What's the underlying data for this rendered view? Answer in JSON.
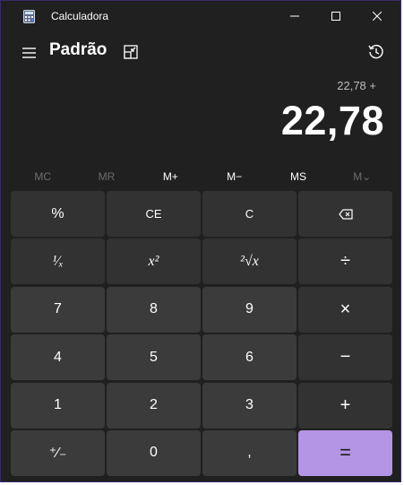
{
  "window": {
    "title": "Calculadora",
    "minimize_icon": "minimize-icon",
    "maximize_icon": "maximize-icon",
    "close_icon": "close-icon"
  },
  "header": {
    "mode": "Padrão",
    "menu_icon": "hamburger-icon",
    "keep_on_top_icon": "keep-on-top-icon",
    "history_icon": "history-icon"
  },
  "display": {
    "expression": "22,78 +",
    "result": "22,78"
  },
  "memory": [
    {
      "label": "MC",
      "enabled": false
    },
    {
      "label": "MR",
      "enabled": false
    },
    {
      "label": "M+",
      "enabled": true
    },
    {
      "label": "M−",
      "enabled": true
    },
    {
      "label": "MS",
      "enabled": true
    },
    {
      "label": "M⌄",
      "enabled": false
    }
  ],
  "keys": {
    "percent": "%",
    "clear_entry": "CE",
    "clear": "C",
    "backspace": "⌫",
    "reciprocal": "¹⁄ₓ",
    "square": "x²",
    "sqrt": "²√x",
    "divide": "÷",
    "seven": "7",
    "eight": "8",
    "nine": "9",
    "multiply": "×",
    "four": "4",
    "five": "5",
    "six": "6",
    "minus": "−",
    "one": "1",
    "two": "2",
    "three": "3",
    "plus": "+",
    "negate": "⁺∕₋",
    "zero": "0",
    "decimal": ",",
    "equals": "="
  },
  "colors": {
    "background": "#202020",
    "function_key": "#323232",
    "number_key": "#3b3b3b",
    "accent": "#b494e4"
  }
}
